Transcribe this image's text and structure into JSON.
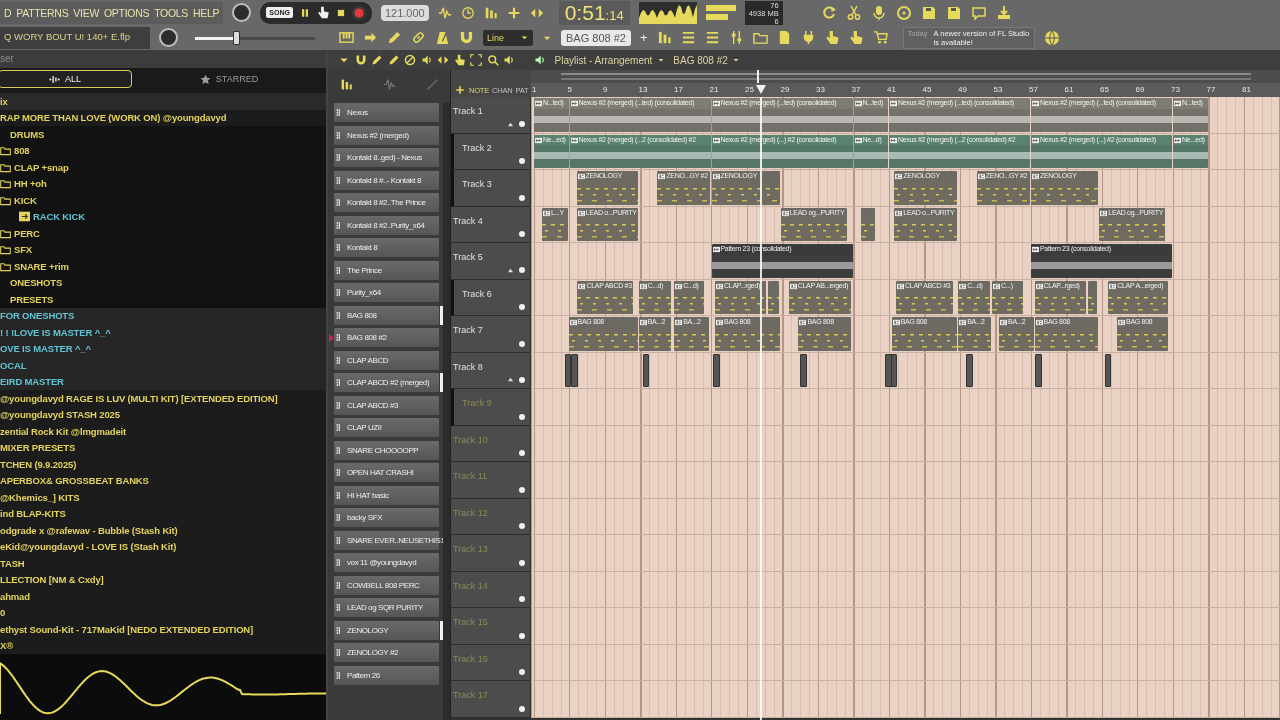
{
  "menu": [
    "D",
    "PATTERNS",
    "VIEW",
    "OPTIONS",
    "TOOLS",
    "HELP"
  ],
  "transport": {
    "mode": "SONG",
    "tempo": "121.000",
    "time": "0:51",
    "time_fraction": ":14"
  },
  "stats": {
    "cpu": "76",
    "memory": "4938 MB",
    "voices": "6"
  },
  "project": {
    "file": "Q WORY BOUT U! 140+ E.flp"
  },
  "master_pitch": {
    "level": 0.34
  },
  "snap": {
    "value": "Line"
  },
  "pattern_selector": {
    "value": "BAG 808 #2",
    "add": "+"
  },
  "news": {
    "label": "Today",
    "message": "A newer version of FL Studio is available!"
  },
  "browser": {
    "title": "ser",
    "tabs": [
      {
        "label": "ALL",
        "selected": true
      },
      {
        "label": "STARRED",
        "selected": false
      }
    ],
    "items": [
      {
        "name": "ix",
        "kind": "folder"
      },
      {
        "name": "RAP MORE THAN LOVE (WORK ON) @youngdavyd",
        "kind": "folder",
        "children": [
          {
            "name": "DRUMS",
            "kind": "folder",
            "children": [
              {
                "name": "808",
                "kind": "folder"
              },
              {
                "name": "CLAP +snap",
                "kind": "folder"
              },
              {
                "name": "HH +oh",
                "kind": "folder"
              },
              {
                "name": "KICK",
                "kind": "folder",
                "children": [
                  {
                    "name": "RACK KICK",
                    "kind": "file"
                  }
                ]
              },
              {
                "name": "PERC",
                "kind": "folder"
              },
              {
                "name": "SFX",
                "kind": "folder"
              },
              {
                "name": "SNARE +rim",
                "kind": "folder"
              }
            ]
          },
          {
            "name": "ONESHOTS",
            "kind": "folder"
          },
          {
            "name": "PRESETS",
            "kind": "folder"
          }
        ]
      },
      {
        "name": "FOR ONESHOTS",
        "kind": "user"
      },
      {
        "name": "! ! !LOVE IS MASTER ^_^",
        "kind": "user"
      },
      {
        "name": "OVE IS MASTER ^_^",
        "kind": "user"
      },
      {
        "name": "OCAL",
        "kind": "user"
      },
      {
        "name": "EIRD MASTER",
        "kind": "user"
      },
      {
        "name": "@youngdavyd RAGE IS LUV (MULTI KIT) [EXTENDED EDITION]",
        "kind": "folder"
      },
      {
        "name": "@youngdavyd STASH 2025",
        "kind": "folder"
      },
      {
        "name": "zential Rock Kit @lmgmadeit",
        "kind": "folder"
      },
      {
        "name": "MIXER PRESETS",
        "kind": "folder"
      },
      {
        "name": "TCHEN (9.9.2025)",
        "kind": "folder"
      },
      {
        "name": "APERBOX& GROSSBEAT BANKS",
        "kind": "folder"
      },
      {
        "name": "@Khemics_]   KITS",
        "kind": "folder"
      },
      {
        "name": "ind BLAP-KITS",
        "kind": "folder"
      },
      {
        "name": "odgrade x @rafewav - Bubble (Stash Kit)",
        "kind": "folder"
      },
      {
        "name": "eKid@youngdavyd - LOVE IS (Stash Kit)",
        "kind": "folder"
      },
      {
        "name": "TASH",
        "kind": "folder"
      },
      {
        "name": "LLECTION [NM & Cxdy]",
        "kind": "folder"
      },
      {
        "name": "ahmad",
        "kind": "folder"
      },
      {
        "name": "0",
        "kind": "folder"
      },
      {
        "name": "ethyst Sound-Kit - 717MaKid [NEDO EXTENDED EDITION]",
        "kind": "folder"
      },
      {
        "name": "X®",
        "kind": "folder"
      }
    ]
  },
  "channels": [
    {
      "name": "Nexus",
      "selected": false,
      "current": false
    },
    {
      "name": "Nexus #2 (merged)",
      "selected": false,
      "current": false
    },
    {
      "name": "Kontakt 8..ged) - Nexus",
      "selected": false,
      "current": false
    },
    {
      "name": "Kontakt 8 #..- Kontakt 8",
      "selected": false,
      "current": false
    },
    {
      "name": "Kontakt 8 #2..The Prince",
      "selected": false,
      "current": false
    },
    {
      "name": "Kontakt 8 #2..Purity_x64",
      "selected": false,
      "current": false
    },
    {
      "name": "Kontakt 8",
      "selected": false,
      "current": false
    },
    {
      "name": "The Prince",
      "selected": false,
      "current": false
    },
    {
      "name": "Purity_x64",
      "selected": false,
      "current": false
    },
    {
      "name": "BAG 808",
      "selected": true,
      "current": false
    },
    {
      "name": "BAG 808 #2",
      "selected": false,
      "current": true
    },
    {
      "name": "CLAP ABCD",
      "selected": false,
      "current": false
    },
    {
      "name": "CLAP ABCD #2 (merged)",
      "selected": true,
      "current": false
    },
    {
      "name": "CLAP ABCD #3",
      "selected": false,
      "current": false
    },
    {
      "name": "CLAP UZI!",
      "selected": false,
      "current": false
    },
    {
      "name": "SNARE CHOOOOPP",
      "selected": false,
      "current": false
    },
    {
      "name": "OPEN HAT CRASH!",
      "selected": false,
      "current": false
    },
    {
      "name": "HI HAT basic",
      "selected": false,
      "current": false
    },
    {
      "name": "backy SFX",
      "selected": false,
      "current": false
    },
    {
      "name": "SNARE EVER..NEUSETHIS1",
      "selected": false,
      "current": false
    },
    {
      "name": "vox 11 @youngdavyd",
      "selected": false,
      "current": false
    },
    {
      "name": "COWBELL 808 PERC",
      "selected": false,
      "current": false
    },
    {
      "name": "LEAD og SQR PURITY",
      "selected": false,
      "current": false
    },
    {
      "name": "ZENOLOGY",
      "selected": true,
      "current": false
    },
    {
      "name": "ZENOLOGY #2",
      "selected": false,
      "current": false
    },
    {
      "name": "Pattern 26",
      "selected": false,
      "current": false
    }
  ],
  "playlist": {
    "title": "Playlist - Arrangement",
    "pattern": "BAG 808 #2",
    "modes": [
      "NOTE",
      "CHAN",
      "PAT"
    ],
    "ruler": [
      "1",
      "5",
      "9",
      "13",
      "17",
      "21",
      "25",
      "29",
      "33",
      "37",
      "41",
      "45",
      "49",
      "53",
      "57",
      "61",
      "65",
      "69",
      "73",
      "77",
      "81"
    ],
    "tracks": [
      {
        "name": "Track 1",
        "empty": false,
        "color": "#7f7c74",
        "clips": [
          {
            "kind": "audio",
            "label": "N...ted)"
          },
          {
            "kind": "audio",
            "label": "Nexus #2 (merged) (...ted) (consolidated)"
          },
          {
            "kind": "audio",
            "label": "Nexus #2 (merged) (...ted) (consolidated)"
          },
          {
            "kind": "audio",
            "label": "N...ted)"
          },
          {
            "kind": "audio",
            "label": "Nexus #2 (merged) (...ted) (consolidated)"
          },
          {
            "kind": "audio",
            "label": "Nexus #2 (merged) (...ted) (consolidated)"
          },
          {
            "kind": "audio",
            "label": "N...ted)"
          }
        ],
        "children": [
          {
            "name": "Track 2",
            "empty": false,
            "color": "#5a8270",
            "clips": [
              {
                "kind": "audio",
                "label": "Ne...ed)"
              },
              {
                "kind": "audio",
                "label": "Nexus #2 (merged) (...2 (consolidated) #2"
              },
              {
                "kind": "audio",
                "label": "Nexus #2 (merged) (...) #2 (consolidated)"
              },
              {
                "kind": "audio",
                "label": "Ne...d)"
              },
              {
                "kind": "audio",
                "label": "Nexus #2 (merged) (...2 (consolidated) #2"
              },
              {
                "kind": "audio",
                "label": "Nexus #2 (merged) (...) #2 (consolidated)"
              },
              {
                "kind": "audio",
                "label": "Ne...ed)"
              }
            ]
          },
          {
            "name": "Track 3",
            "empty": false,
            "color": "#6d6a63",
            "clips": [
              {
                "kind": "pattern",
                "label": "ZENOLOGY"
              },
              {
                "kind": "pattern",
                "label": "ZENO...GY #2"
              },
              {
                "kind": "pattern",
                "label": "ZENOLOGY"
              },
              {
                "kind": "pattern",
                "label": "ZENOLOGY"
              },
              {
                "kind": "pattern",
                "label": "ZENO...GY #2"
              },
              {
                "kind": "pattern",
                "label": "ZENOLOGY"
              }
            ]
          }
        ]
      },
      {
        "name": "Track 4",
        "empty": false,
        "color": "#6d6a63",
        "clips": [
          {
            "kind": "pattern",
            "label": "L...Y"
          },
          {
            "kind": "pattern",
            "label": "LEAD o...PURITY"
          },
          {
            "kind": "pattern",
            "label": "LEAD og...PURITY"
          },
          {
            "kind": "pattern"
          },
          {
            "kind": "pattern",
            "label": "LEAD o...PURITY"
          },
          {
            "kind": "pattern",
            "label": "LEAD og...PURITY"
          }
        ]
      },
      {
        "name": "Track 5",
        "empty": false,
        "color": "#3b3b3b",
        "clips": [
          {
            "kind": "audio",
            "label": "Pattern 23 (consolidated)"
          },
          {
            "kind": "audio",
            "label": "Pattern 23 (consolidated)"
          }
        ],
        "children": [
          {
            "name": "Track 6",
            "empty": false,
            "color": "#6d6a63",
            "clips": [
              {
                "kind": "pattern",
                "label": "CLAP ABCD #3"
              },
              {
                "kind": "pattern",
                "label": "C...d)"
              },
              {
                "kind": "pattern",
                "label": "C...d)"
              },
              {
                "kind": "pattern",
                "label": "CLAP...rged)"
              },
              {
                "kind": "pattern"
              },
              {
                "kind": "pattern",
                "label": "CLAP AB...erged)"
              },
              {
                "kind": "pattern",
                "label": "CLAP ABCD #3"
              },
              {
                "kind": "pattern",
                "label": "C...d)"
              },
              {
                "kind": "pattern",
                "label": "C...)"
              },
              {
                "kind": "pattern",
                "label": "CLAP...rged)"
              },
              {
                "kind": "pattern"
              },
              {
                "kind": "pattern",
                "label": "CLAP A...erged)"
              }
            ]
          }
        ]
      },
      {
        "name": "Track 7",
        "empty": false,
        "color": "#6d6a63",
        "clips": [
          {
            "kind": "pattern",
            "label": "BAG 808"
          },
          {
            "kind": "pattern",
            "label": "BA...2"
          },
          {
            "kind": "pattern",
            "label": "BA...2"
          },
          {
            "kind": "pattern",
            "label": "BAG 808"
          },
          {
            "kind": "pattern",
            "label": "BAG 808"
          },
          {
            "kind": "pattern",
            "label": "BAG 808"
          },
          {
            "kind": "pattern",
            "label": "BA...2"
          },
          {
            "kind": "pattern",
            "label": "BA...2"
          },
          {
            "kind": "pattern",
            "label": "BAG 808"
          },
          {
            "kind": "pattern",
            "label": "BAG 808"
          }
        ]
      },
      {
        "name": "Track 8",
        "empty": false,
        "clips": [
          {
            "kind": "marker"
          },
          {
            "kind": "marker"
          },
          {
            "kind": "marker"
          },
          {
            "kind": "marker"
          },
          {
            "kind": "marker"
          },
          {
            "kind": "marker"
          },
          {
            "kind": "marker"
          },
          {
            "kind": "marker"
          },
          {
            "kind": "marker"
          },
          {
            "kind": "marker"
          }
        ],
        "children": [
          {
            "name": "Track 9",
            "empty": true
          }
        ]
      },
      {
        "name": "Track 10",
        "empty": true
      },
      {
        "name": "Track 11",
        "empty": true
      },
      {
        "name": "Track 12",
        "empty": true
      },
      {
        "name": "Track 13",
        "empty": true
      },
      {
        "name": "Track 14",
        "empty": true
      },
      {
        "name": "Track 15",
        "empty": true
      },
      {
        "name": "Track 16",
        "empty": true
      },
      {
        "name": "Track 17",
        "empty": true
      }
    ]
  }
}
